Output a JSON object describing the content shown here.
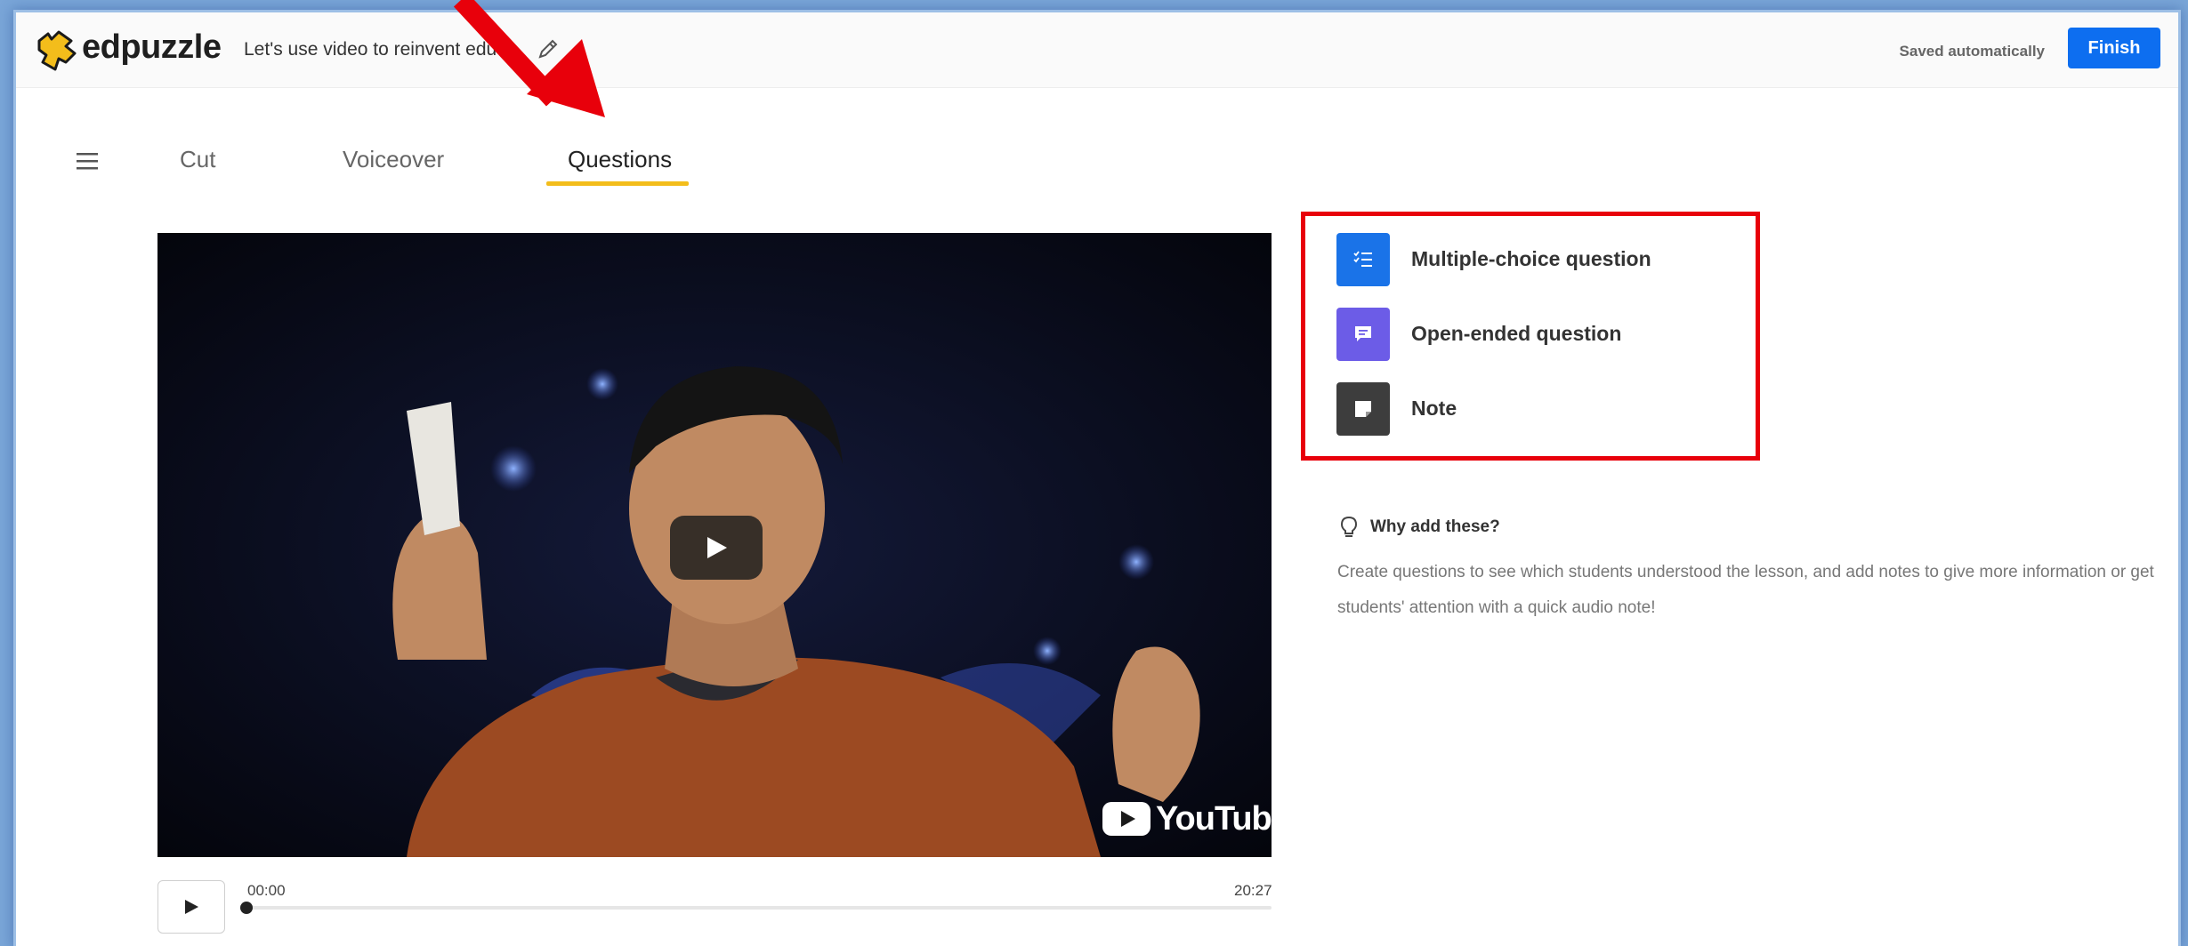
{
  "app": {
    "name": "edpuzzle",
    "brand_color": "#f3bd1b"
  },
  "header": {
    "title": "Let's use video to reinvent edu",
    "saved_status": "Saved automatically",
    "finish_label": "Finish"
  },
  "tabs": [
    {
      "label": "Cut",
      "active": false
    },
    {
      "label": "Voiceover",
      "active": false
    },
    {
      "label": "Questions",
      "active": true
    }
  ],
  "player": {
    "current_time": "00:00",
    "duration": "20:27",
    "progress": 0,
    "youtube_label": "YouTube"
  },
  "options": [
    {
      "label": "Multiple-choice question",
      "icon": "checklist-icon",
      "color": "#1a73e8"
    },
    {
      "label": "Open-ended question",
      "icon": "speech-bubble-icon",
      "color": "#6c5ce7"
    },
    {
      "label": "Note",
      "icon": "sticky-note-icon",
      "color": "#3d3d3d"
    }
  ],
  "info": {
    "title": "Why add these?",
    "description": "Create questions to see which students understood the lesson, and add notes to give more information or get students' attention with a quick audio note!"
  },
  "annotation_color": "#e8000b"
}
